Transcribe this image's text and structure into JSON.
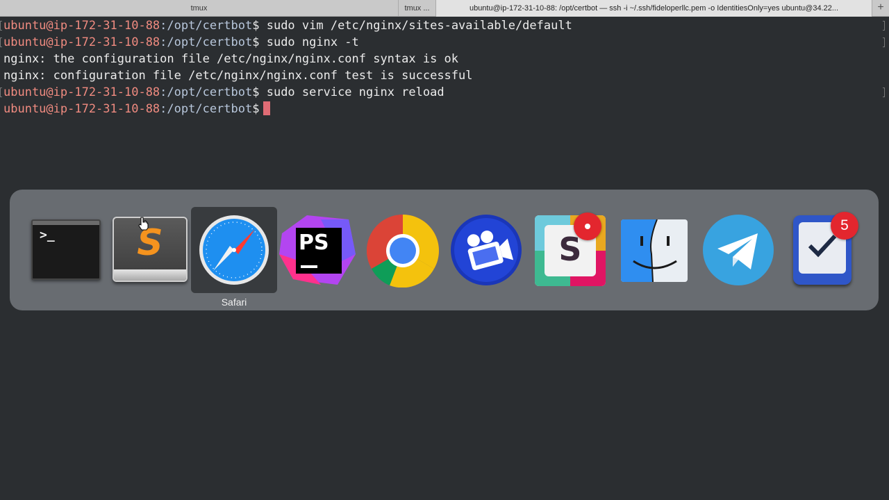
{
  "tabs": [
    {
      "label": "tmux"
    },
    {
      "label": "tmux ..."
    },
    {
      "label": "ubuntu@ip-172-31-10-88: /opt/certbot — ssh -i ~/.ssh/fideloperllc.pem -o IdentitiesOnly=yes ubuntu@34.22..."
    }
  ],
  "tab_add": "+",
  "terminal": {
    "lines": [
      {
        "user": "ubuntu@ip-172-31-10-88",
        "path": ":/opt/certbot",
        "prompt": "$ ",
        "cmd": "sudo vim /etc/nginx/sites-available/default"
      },
      {
        "user": "ubuntu@ip-172-31-10-88",
        "path": ":/opt/certbot",
        "prompt": "$ ",
        "cmd": "sudo nginx -t"
      },
      {
        "output": "nginx: the configuration file /etc/nginx/nginx.conf syntax is ok"
      },
      {
        "output": "nginx: configuration file /etc/nginx/nginx.conf test is successful"
      },
      {
        "user": "ubuntu@ip-172-31-10-88",
        "path": ":/opt/certbot",
        "prompt": "$ ",
        "cmd": "sudo service nginx reload"
      },
      {
        "user": "ubuntu@ip-172-31-10-88",
        "path": ":/opt/certbot",
        "prompt": "$",
        "cmd": ""
      }
    ]
  },
  "app_switcher": {
    "selected_label": "Safari",
    "apps": [
      {
        "name": "terminal-icon"
      },
      {
        "name": "sublime-text-icon"
      },
      {
        "name": "safari-icon",
        "label": "Safari"
      },
      {
        "name": "phpstorm-icon"
      },
      {
        "name": "chrome-icon"
      },
      {
        "name": "screenflow-icon"
      },
      {
        "name": "slack-icon",
        "badge": "dot"
      },
      {
        "name": "finder-icon"
      },
      {
        "name": "telegram-icon"
      },
      {
        "name": "things-icon",
        "badge": "5"
      }
    ],
    "terminal_glyph": ">_",
    "sublime_glyph": "S",
    "phpstorm_glyph": "PS",
    "slack_glyph": "S",
    "things_badge": "5"
  },
  "colors": {
    "background": "#2b2e31",
    "prompt_user": "#f08b80",
    "prompt_path": "#b8c7dc",
    "cursor": "#e06c75",
    "badge": "#e3262e"
  }
}
